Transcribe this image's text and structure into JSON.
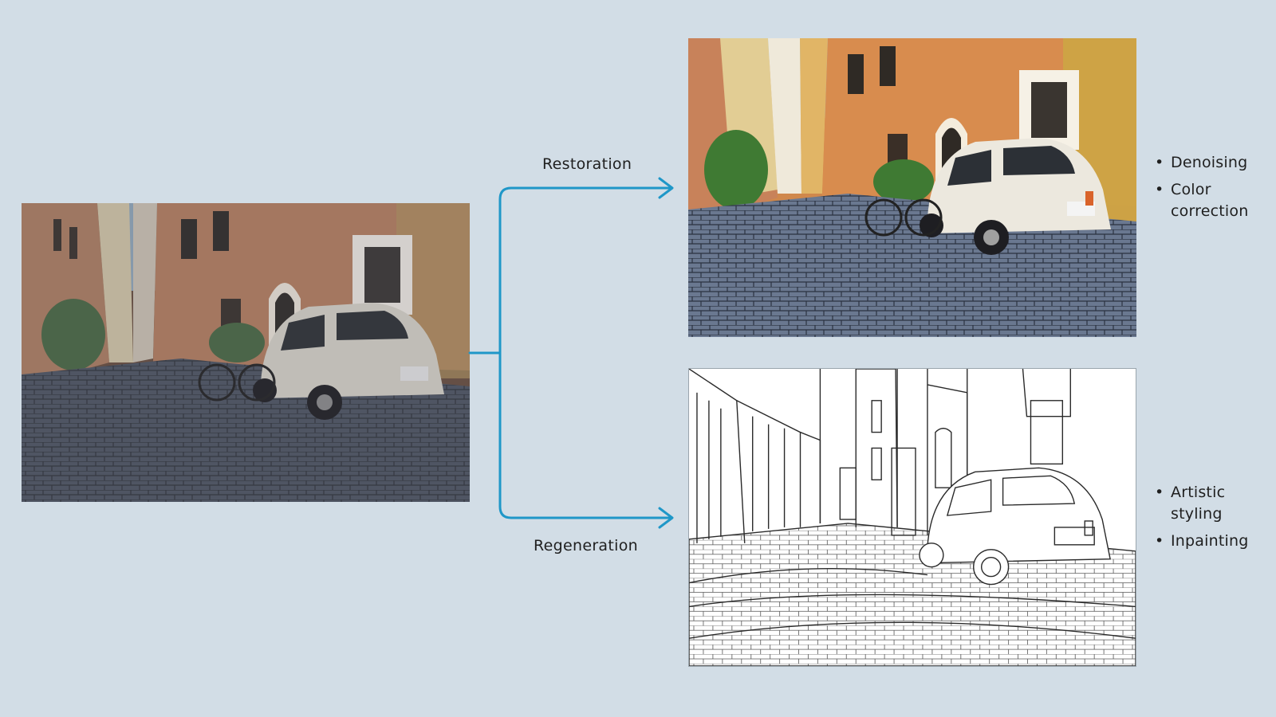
{
  "branches": {
    "restoration": {
      "label": "Restoration",
      "bullets": [
        "Denoising",
        "Color correction"
      ]
    },
    "regeneration": {
      "label": "Regeneration",
      "bullets": [
        "Artistic styling",
        "Inpainting"
      ]
    }
  },
  "colors": {
    "background": "#d2dde6",
    "connector": "#1f97c8",
    "wall_orange": "#c88549",
    "wall_yellow": "#d8b25d",
    "cobblestone": "#5f6b7e",
    "car_white": "#e6e2d8",
    "sky": "#8fc3e6"
  },
  "icons": {
    "input_image": "street-photo",
    "restored_image": "street-photo-restored",
    "regenerated_image": "street-line-sketch",
    "connector_arrow": "arrow-right-icon"
  }
}
